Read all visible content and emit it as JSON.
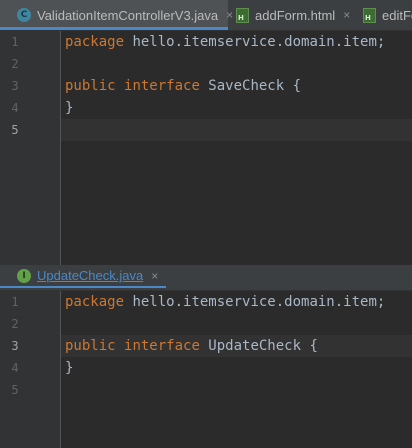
{
  "top_pane": {
    "tabs": [
      {
        "label": "ValidationItemControllerV3.java",
        "icon": "java-class-icon",
        "close": "×"
      },
      {
        "label": "addForm.html",
        "icon": "html-file-icon",
        "close": "×"
      },
      {
        "label": "editFo",
        "icon": "html-file-icon"
      }
    ],
    "line_numbers": [
      "1",
      "2",
      "3",
      "4",
      "5"
    ],
    "code": {
      "l1": {
        "kw": "package",
        "rest": " hello.itemservice.domain.item;"
      },
      "l3": {
        "kw1": "public",
        "kw2": "interface",
        "rest": " SaveCheck {"
      },
      "l4": "}"
    }
  },
  "bottom_pane": {
    "tab": {
      "label": "UpdateCheck.java",
      "icon": "java-interface-icon",
      "close": "×"
    },
    "line_numbers": [
      "1",
      "2",
      "3",
      "4",
      "5"
    ],
    "code": {
      "l1": {
        "kw": "package",
        "rest": " hello.itemservice.domain.item;"
      },
      "l3": {
        "kw1": "public",
        "kw2": "interface",
        "rest": " UpdateCheck {"
      },
      "l4": "}"
    }
  },
  "colors": {
    "background": "#2b2b2b",
    "gutter": "#313335",
    "keyword": "#cc7832",
    "text": "#a9b7c6",
    "line_number": "#606366",
    "accent": "#4a88c7"
  }
}
